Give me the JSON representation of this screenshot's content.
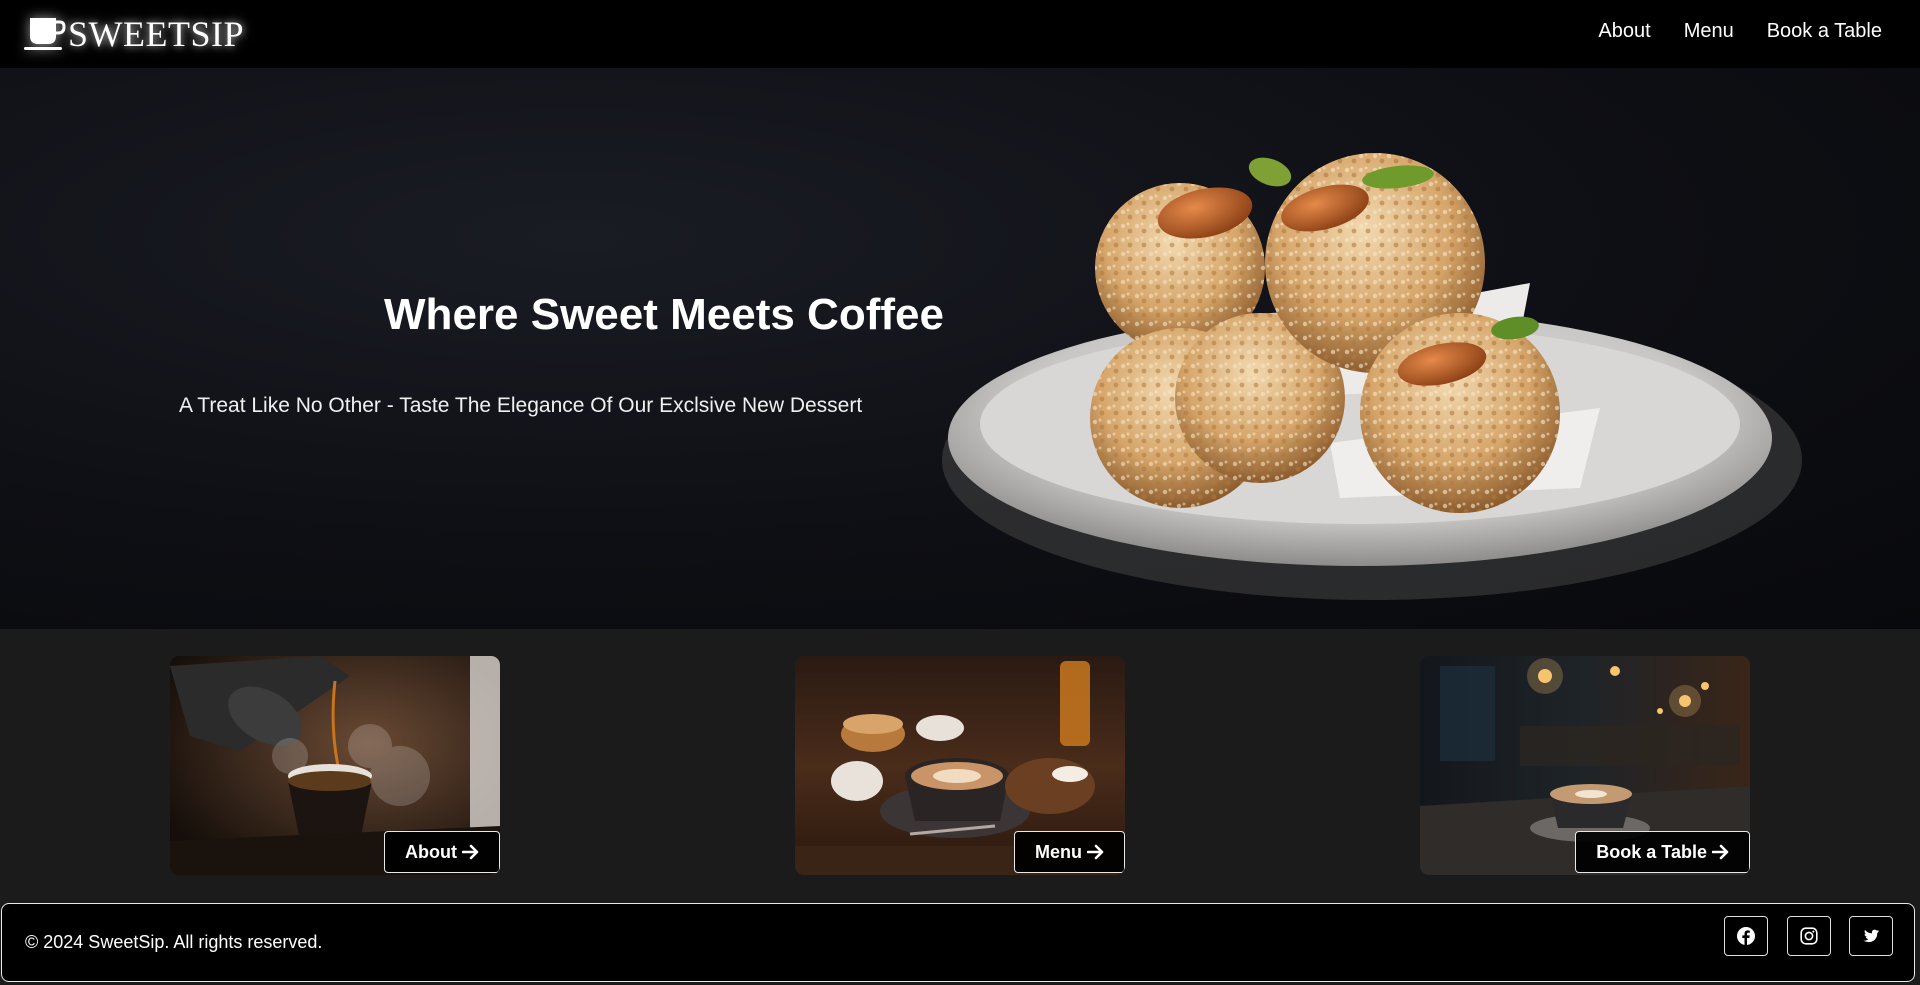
{
  "brand": {
    "name": "SWEETSIP",
    "logo_icon": "coffee-cup-icon"
  },
  "nav": {
    "links": [
      {
        "label": "About"
      },
      {
        "label": "Menu"
      },
      {
        "label": "Book a Table"
      }
    ]
  },
  "hero": {
    "title": "Where Sweet Meets Coffee",
    "subtitle": "A Treat Like No Other - Taste The Elegance Of Our Exclsive New Dessert"
  },
  "cards": [
    {
      "button_label": "About",
      "icon": "arrow-right-icon"
    },
    {
      "button_label": "Menu",
      "icon": "arrow-right-icon"
    },
    {
      "button_label": "Book a Table",
      "icon": "arrow-right-icon"
    }
  ],
  "footer": {
    "copyright": "© 2024 SweetSip. All rights reserved.",
    "social_icons": [
      "facebook-icon",
      "instagram-icon",
      "twitter-icon"
    ]
  },
  "colors": {
    "nav_bg": "#000000",
    "page_bg": "#1b1b1b",
    "text": "#ffffff",
    "border": "#e8e8e8"
  }
}
